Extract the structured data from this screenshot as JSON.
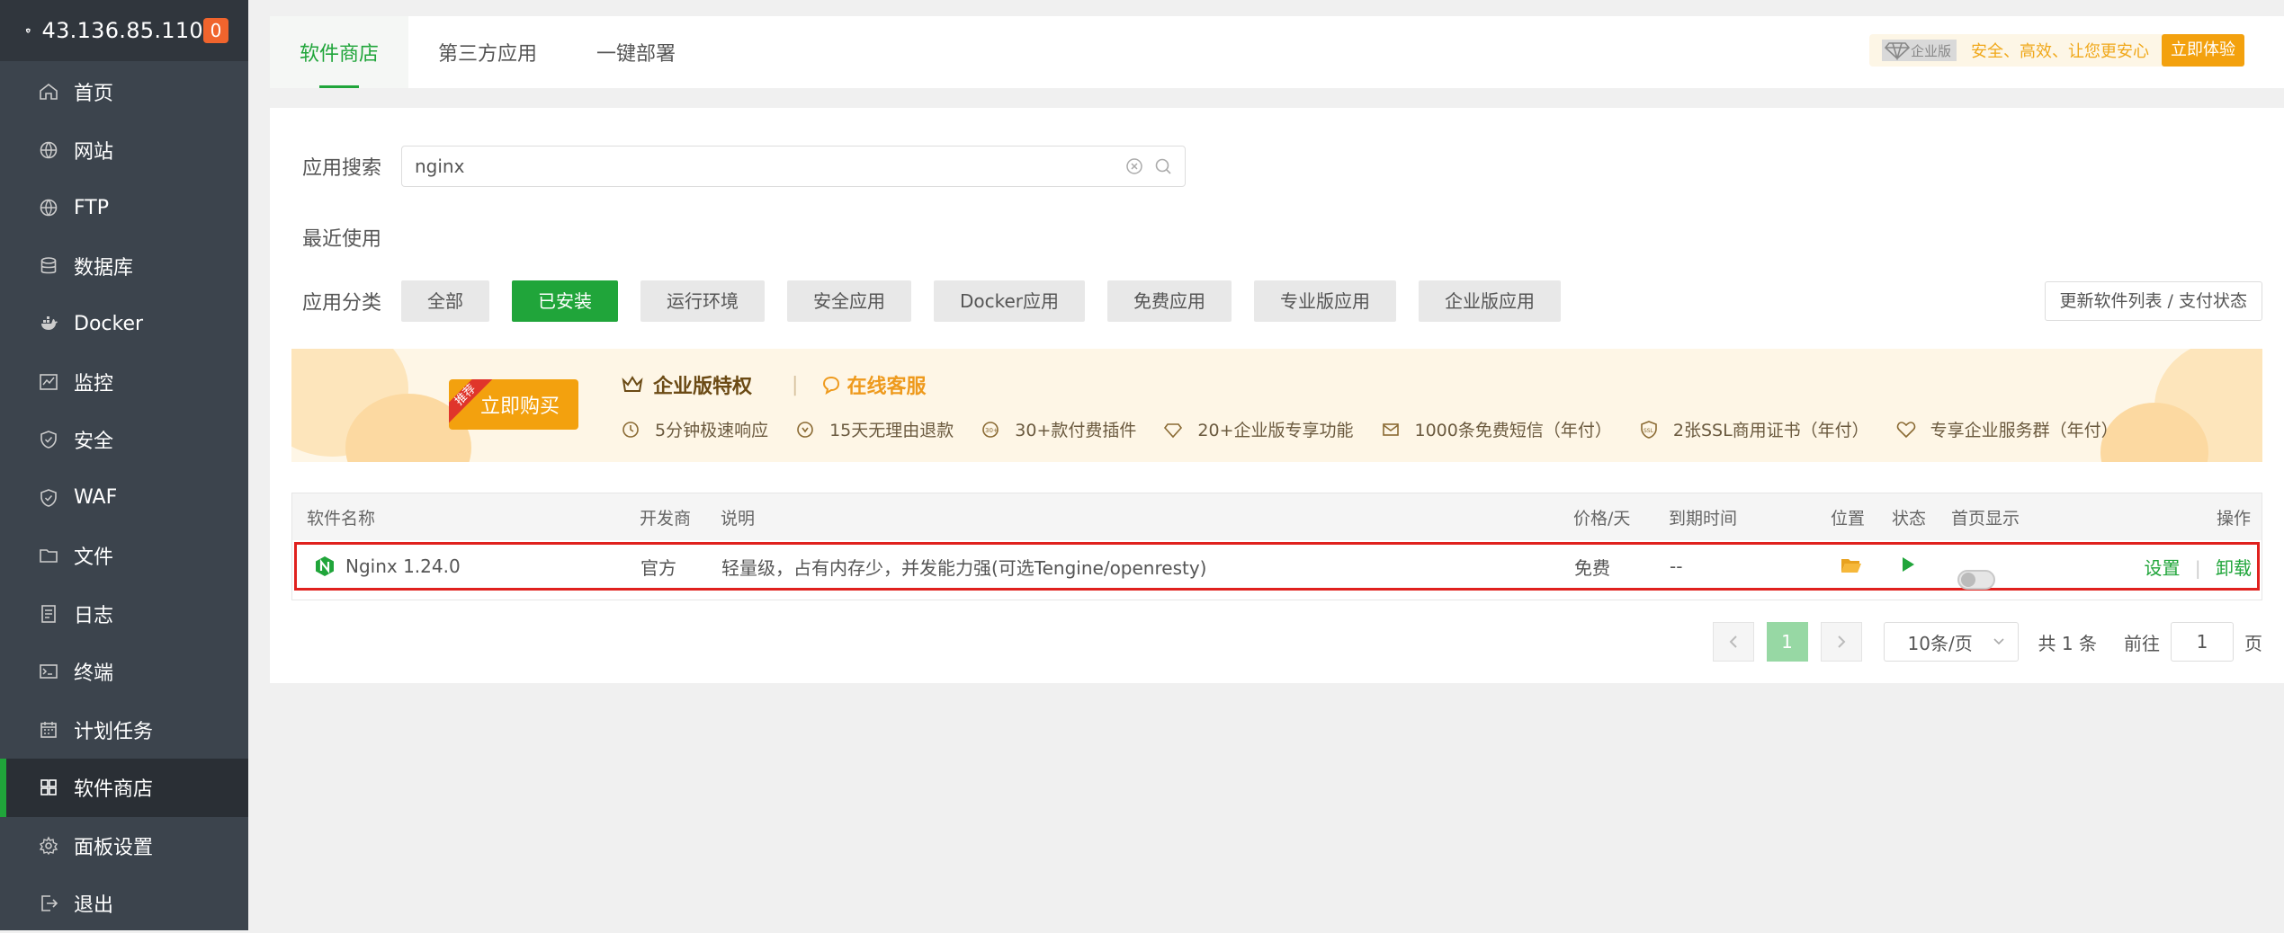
{
  "sidebar": {
    "ip": "43.136.85.110",
    "badge": "0",
    "items": [
      {
        "label": "首页",
        "icon": "home-icon"
      },
      {
        "label": "网站",
        "icon": "globe-icon"
      },
      {
        "label": "FTP",
        "icon": "globe-icon"
      },
      {
        "label": "数据库",
        "icon": "database-icon"
      },
      {
        "label": "Docker",
        "icon": "docker-icon"
      },
      {
        "label": "监控",
        "icon": "monitor-icon"
      },
      {
        "label": "安全",
        "icon": "shield-icon"
      },
      {
        "label": "WAF",
        "icon": "shield-icon"
      },
      {
        "label": "文件",
        "icon": "folder-icon"
      },
      {
        "label": "日志",
        "icon": "log-icon"
      },
      {
        "label": "终端",
        "icon": "terminal-icon"
      },
      {
        "label": "计划任务",
        "icon": "calendar-icon"
      },
      {
        "label": "软件商店",
        "icon": "grid-icon"
      },
      {
        "label": "面板设置",
        "icon": "gear-icon"
      },
      {
        "label": "退出",
        "icon": "logout-icon"
      }
    ],
    "active_index": 12
  },
  "tabs": [
    "软件商店",
    "第三方应用",
    "一键部署"
  ],
  "enterprise": {
    "tag": "企业版",
    "slogan": "安全、高效、让您更安心",
    "try_label": "立即体验"
  },
  "search": {
    "label": "应用搜索",
    "value": "nginx"
  },
  "recent_label": "最近使用",
  "category": {
    "label": "应用分类",
    "chips": [
      "全部",
      "已安装",
      "运行环境",
      "安全应用",
      "Docker应用",
      "免费应用",
      "专业版应用",
      "企业版应用"
    ],
    "active_index": 1,
    "refresh_label": "更新软件列表 / 支付状态"
  },
  "banner": {
    "ribbon": "推荐",
    "buy_label": "立即购买",
    "title": "企业版特权",
    "service": "在线客服",
    "perks": [
      "5分钟极速响应",
      "15天无理由退款",
      "30+款付费插件",
      "20+企业版专享功能",
      "1000条免费短信（年付）",
      "2张SSL商用证书（年付）",
      "专享企业服务群（年付）"
    ]
  },
  "table": {
    "headers": {
      "name": "软件名称",
      "dev": "开发商",
      "desc": "说明",
      "price": "价格/天",
      "expire": "到期时间",
      "loc": "位置",
      "status": "状态",
      "home": "首页显示",
      "ops": "操作"
    },
    "rows": [
      {
        "name": "Nginx 1.24.0",
        "dev": "官方",
        "desc": "轻量级，占有内存少，并发能力强(可选Tengine/openresty)",
        "price": "免费",
        "expire": "--",
        "ops_settings": "设置",
        "ops_sep": "|",
        "ops_uninstall": "卸载"
      }
    ]
  },
  "pager": {
    "current": "1",
    "size": "10条/页",
    "total": "共 1 条",
    "goto": "前往",
    "goto_value": "1",
    "page_unit": "页"
  },
  "colors": {
    "accent": "#20a53a",
    "sidebar": "#3c444d",
    "orange": "#f3a10e"
  }
}
